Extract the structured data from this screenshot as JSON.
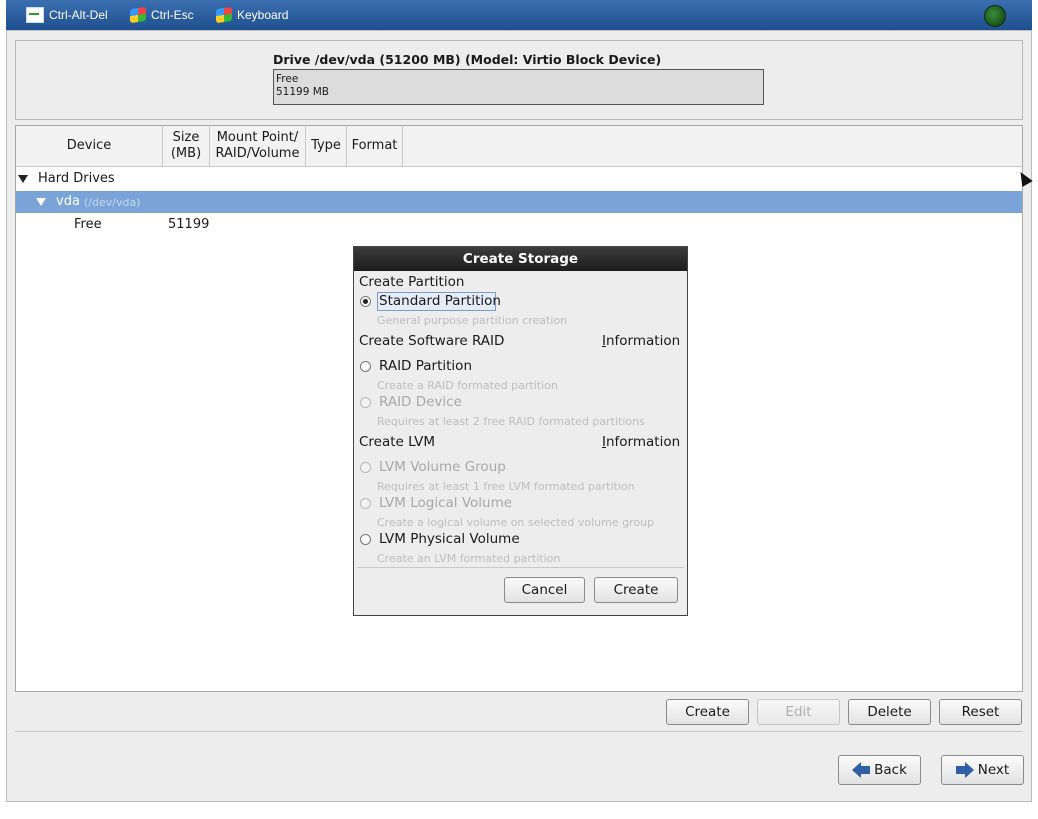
{
  "toolbar": {
    "ctrl_alt_del": "Ctrl-Alt-Del",
    "ctrl_esc": "Ctrl-Esc",
    "keyboard": "Keyboard"
  },
  "drive": {
    "title": "Drive /dev/vda (51200 MB) (Model: Virtio Block Device)",
    "bar_label": "Free",
    "bar_size": "51199 MB"
  },
  "table": {
    "columns": [
      "Device",
      "Size\n(MB)",
      "Mount Point/\nRAID/Volume",
      "Type",
      "Format"
    ],
    "group": "Hard Drives",
    "disk_name": "vda",
    "disk_path": "(/dev/vda)",
    "free_label": "Free",
    "free_size": "51199"
  },
  "dialog": {
    "title": "Create Storage",
    "section_partition": "Create Partition",
    "standard_label": "Standard Partition",
    "standard_desc": "General purpose partition creation",
    "section_raid": "Create Software RAID",
    "info_label": "Information",
    "raid_partition_label": "RAID Partition",
    "raid_partition_desc": "Create a RAID formated partition",
    "raid_device_label": "RAID Device",
    "raid_device_desc": "Requires at least 2 free RAID formated partitions",
    "section_lvm": "Create LVM",
    "lvm_vg_label": "LVM Volume Group",
    "lvm_vg_desc": "Requires at least 1 free LVM formated partition",
    "lvm_lv_label": "LVM Logical Volume",
    "lvm_lv_desc": "Create a logical volume on selected volume group",
    "lvm_pv_label": "LVM Physical Volume",
    "lvm_pv_desc": "Create an LVM formated partition",
    "cancel": "Cancel",
    "create": "Create"
  },
  "actions": {
    "create": "Create",
    "edit": "Edit",
    "delete": "Delete",
    "reset": "Reset"
  },
  "nav": {
    "back": "Back",
    "next": "Next"
  },
  "colors": {
    "selected_row": "#7aa4d8",
    "toolbar": "#2a5c9e"
  }
}
